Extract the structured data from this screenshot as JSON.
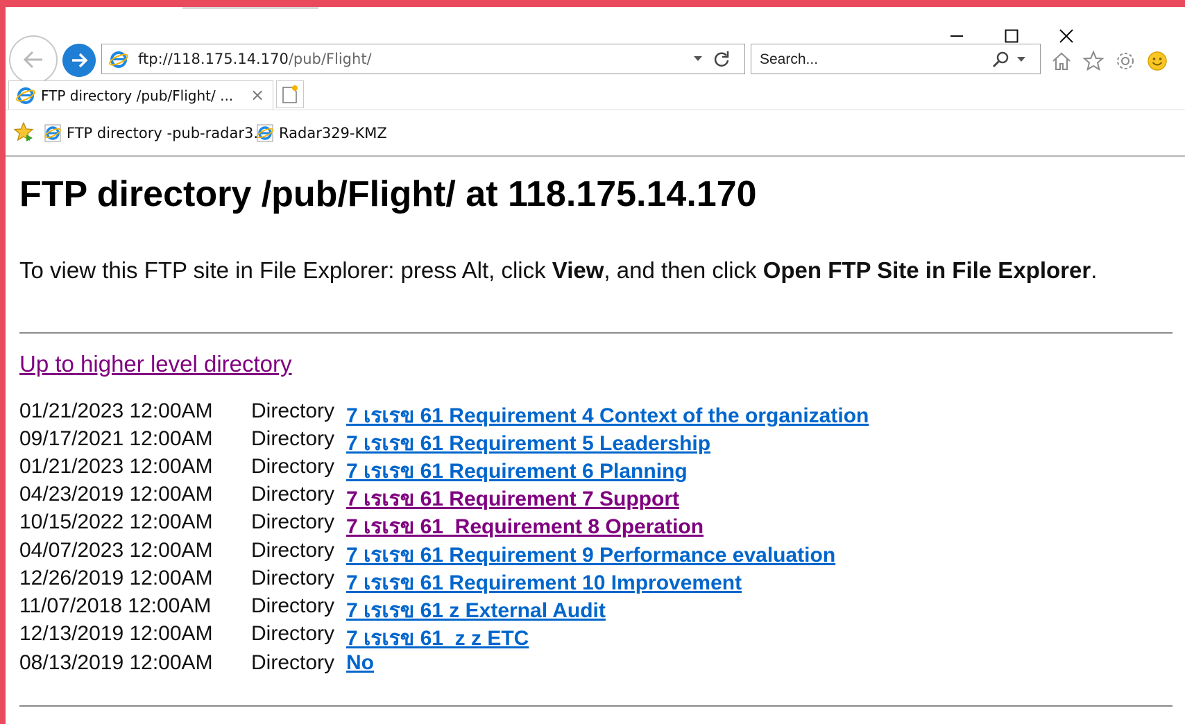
{
  "browser": {
    "address": {
      "host": "ftp://118.175.14.170",
      "path": "/pub/Flight/"
    },
    "search": {
      "placeholder": "Search..."
    },
    "tab": {
      "label": "FTP directory /pub/Flight/ ...",
      "close": "×"
    },
    "favorites": [
      {
        "label": "FTP directory -pub-radar3..."
      },
      {
        "label": "Radar329-KMZ"
      }
    ],
    "caption_icons": [
      "minimize-icon",
      "maximize-icon",
      "close-icon"
    ],
    "toolbar_icons": [
      "home-icon",
      "favorites-star-icon",
      "settings-gear-icon",
      "smiley-feedback-icon"
    ],
    "colors": {
      "link": "#0066cc",
      "visited": "#800080",
      "nav_forward": "#1e7fd4",
      "frame": "#e94a5c"
    }
  },
  "page": {
    "title": "FTP directory /pub/Flight/ at 118.175.14.170",
    "instructions": {
      "part1": "To view this FTP site in File Explorer: press Alt, click ",
      "bold1": "View",
      "part2": ", and then click ",
      "bold2": "Open FTP Site in File Explorer",
      "part3": "."
    },
    "up_link": "Up to higher level directory",
    "entries": [
      {
        "date": "01/21/2023 12:00AM",
        "type": "Directory",
        "name": "7 เรเรข 61  Requirement 4 Context of the organization",
        "visited": false
      },
      {
        "date": "09/17/2021 12:00AM",
        "type": "Directory",
        "name": "7 เรเรข 61  Requirement 5 Leadership",
        "visited": false
      },
      {
        "date": "01/21/2023 12:00AM",
        "type": "Directory",
        "name": "7 เรเรข 61  Requirement 6 Planning",
        "visited": false
      },
      {
        "date": "04/23/2019 12:00AM",
        "type": "Directory",
        "name": "7 เรเรข 61  Requirement 7 Support",
        "visited": true
      },
      {
        "date": "10/15/2022 12:00AM",
        "type": "Directory",
        "name": "7 เรเรข 61_Requirement 8 Operation",
        "visited": true
      },
      {
        "date": "04/07/2023 12:00AM",
        "type": "Directory",
        "name": "7 เรเรข 61  Requirement 9 Performance evaluation",
        "visited": false
      },
      {
        "date": "12/26/2019 12:00AM",
        "type": "Directory",
        "name": "7 เรเรข 61  Requirement  10 Improvement",
        "visited": false
      },
      {
        "date": "11/07/2018 12:00AM",
        "type": "Directory",
        "name": "7 เรเรข 61  z External Audit",
        "visited": false
      },
      {
        "date": "12/13/2019 12:00AM",
        "type": "Directory",
        "name": "7 เรเรข 61_z z ETC",
        "visited": false
      },
      {
        "date": "08/13/2019 12:00AM",
        "type": "Directory",
        "name": "No",
        "visited": false
      }
    ]
  }
}
